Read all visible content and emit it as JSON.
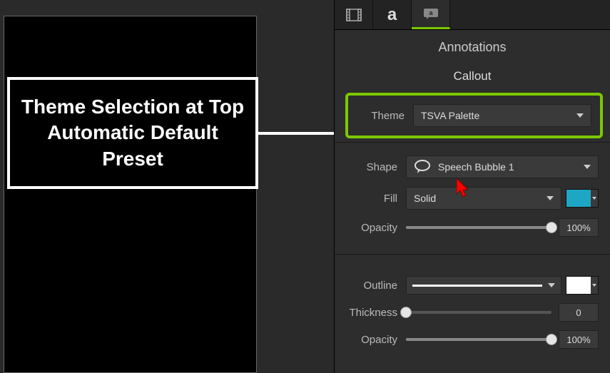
{
  "canvas": {
    "callout_text": "Theme Selection at Top Automatic Default Preset"
  },
  "panel": {
    "title": "Annotations",
    "section": "Callout",
    "theme": {
      "label": "Theme",
      "value": "TSVA Palette"
    },
    "shape": {
      "label": "Shape",
      "value": "Speech Bubble 1"
    },
    "fill": {
      "label": "Fill",
      "value": "Solid",
      "color": "#1ea7c4"
    },
    "fill_opacity": {
      "label": "Opacity",
      "value": "100%",
      "percent": 100
    },
    "outline": {
      "label": "Outline",
      "color": "#ffffff"
    },
    "thickness": {
      "label": "Thickness",
      "value": "0",
      "percent": 0
    },
    "outline_opacity": {
      "label": "Opacity",
      "value": "100%",
      "percent": 100
    }
  }
}
